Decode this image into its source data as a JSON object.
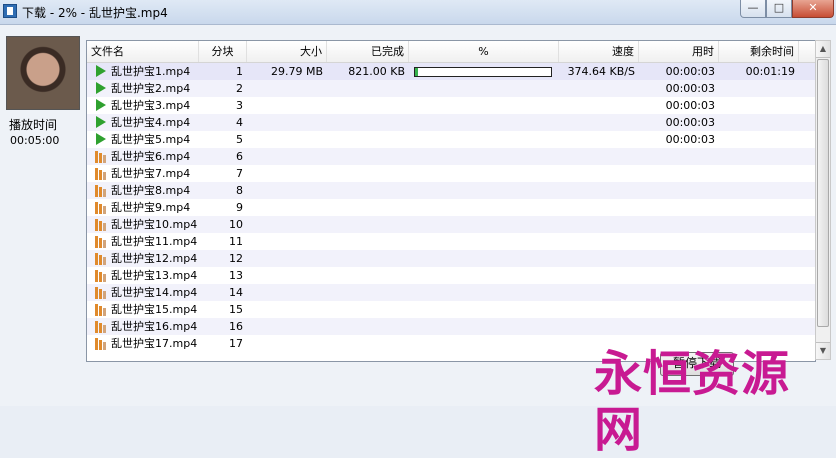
{
  "window": {
    "title": "下载 - 2% - 乱世护宝.mp4",
    "min_glyph": "—",
    "max_glyph": "□",
    "close_glyph": "✕"
  },
  "side": {
    "play_label": "播放时间",
    "play_time": "00:05:00"
  },
  "columns": [
    "文件名",
    "分块",
    "大小",
    "已完成",
    "%",
    "速度",
    "用时",
    "剩余时间"
  ],
  "rows": [
    {
      "icon": "play",
      "name": "乱世护宝1.mp4",
      "block": "1",
      "size": "29.79 MB",
      "done": "821.00 KB",
      "percent": 0.02,
      "speed": "374.64 KB/S",
      "used": "00:00:03",
      "remain": "00:01:19"
    },
    {
      "icon": "play",
      "name": "乱世护宝2.mp4",
      "block": "2",
      "size": "",
      "done": "",
      "percent": null,
      "speed": "",
      "used": "00:00:03",
      "remain": ""
    },
    {
      "icon": "play",
      "name": "乱世护宝3.mp4",
      "block": "3",
      "size": "",
      "done": "",
      "percent": null,
      "speed": "",
      "used": "00:00:03",
      "remain": ""
    },
    {
      "icon": "play",
      "name": "乱世护宝4.mp4",
      "block": "4",
      "size": "",
      "done": "",
      "percent": null,
      "speed": "",
      "used": "00:00:03",
      "remain": ""
    },
    {
      "icon": "play",
      "name": "乱世护宝5.mp4",
      "block": "5",
      "size": "",
      "done": "",
      "percent": null,
      "speed": "",
      "used": "00:00:03",
      "remain": ""
    },
    {
      "icon": "bars",
      "name": "乱世护宝6.mp4",
      "block": "6",
      "size": "",
      "done": "",
      "percent": null,
      "speed": "",
      "used": "",
      "remain": ""
    },
    {
      "icon": "bars",
      "name": "乱世护宝7.mp4",
      "block": "7",
      "size": "",
      "done": "",
      "percent": null,
      "speed": "",
      "used": "",
      "remain": ""
    },
    {
      "icon": "bars",
      "name": "乱世护宝8.mp4",
      "block": "8",
      "size": "",
      "done": "",
      "percent": null,
      "speed": "",
      "used": "",
      "remain": ""
    },
    {
      "icon": "bars",
      "name": "乱世护宝9.mp4",
      "block": "9",
      "size": "",
      "done": "",
      "percent": null,
      "speed": "",
      "used": "",
      "remain": ""
    },
    {
      "icon": "bars",
      "name": "乱世护宝10.mp4",
      "block": "10",
      "size": "",
      "done": "",
      "percent": null,
      "speed": "",
      "used": "",
      "remain": ""
    },
    {
      "icon": "bars",
      "name": "乱世护宝11.mp4",
      "block": "11",
      "size": "",
      "done": "",
      "percent": null,
      "speed": "",
      "used": "",
      "remain": ""
    },
    {
      "icon": "bars",
      "name": "乱世护宝12.mp4",
      "block": "12",
      "size": "",
      "done": "",
      "percent": null,
      "speed": "",
      "used": "",
      "remain": ""
    },
    {
      "icon": "bars",
      "name": "乱世护宝13.mp4",
      "block": "13",
      "size": "",
      "done": "",
      "percent": null,
      "speed": "",
      "used": "",
      "remain": ""
    },
    {
      "icon": "bars",
      "name": "乱世护宝14.mp4",
      "block": "14",
      "size": "",
      "done": "",
      "percent": null,
      "speed": "",
      "used": "",
      "remain": ""
    },
    {
      "icon": "bars",
      "name": "乱世护宝15.mp4",
      "block": "15",
      "size": "",
      "done": "",
      "percent": null,
      "speed": "",
      "used": "",
      "remain": ""
    },
    {
      "icon": "bars",
      "name": "乱世护宝16.mp4",
      "block": "16",
      "size": "",
      "done": "",
      "percent": null,
      "speed": "",
      "used": "",
      "remain": ""
    },
    {
      "icon": "bars",
      "name": "乱世护宝17.mp4",
      "block": "17",
      "size": "",
      "done": "",
      "percent": null,
      "speed": "",
      "used": "",
      "remain": ""
    }
  ],
  "action_button": "暂停下载",
  "watermark": "永恒资源网",
  "colors": {
    "progress_fill": "#37b24d",
    "play_icon": "#2fa12f",
    "watermark": "#c81a92"
  }
}
